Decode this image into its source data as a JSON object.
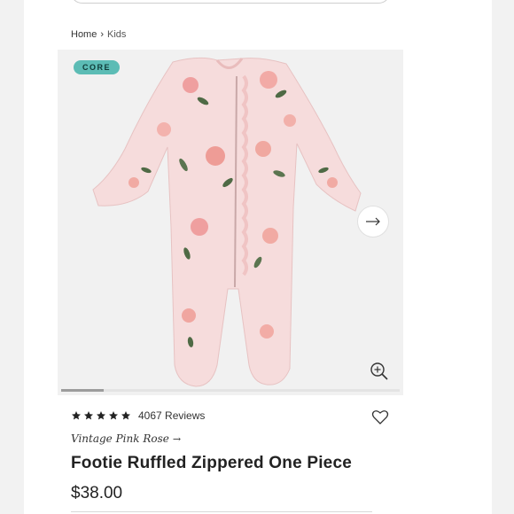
{
  "breadcrumb": {
    "home": "Home",
    "separator": "›",
    "current": "Kids"
  },
  "gallery": {
    "badge": "CORE",
    "image_index": 1,
    "image_count": 8,
    "next_icon": "arrow-right-icon",
    "zoom_icon": "zoom-in-icon"
  },
  "product": {
    "rating_stars": 5,
    "reviews_label": "4067 Reviews",
    "variant_label": "Vintage Pink Rose",
    "variant_arrow": "→",
    "title": "Footie Ruffled Zippered One Piece",
    "price": "$38.00"
  },
  "colors": {
    "badge_bg": "#5cbcb5",
    "page_bg": "#ffffff",
    "gallery_bg": "#f1f1f1",
    "garment_pink": "#f6dcdc",
    "rose": "#ef9f9f",
    "leaf": "#4f6a45"
  }
}
